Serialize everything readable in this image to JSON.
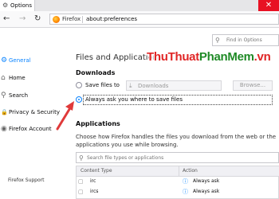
{
  "tab": {
    "title": "Options"
  },
  "window": {
    "close_glyph": "✕"
  },
  "toolbar": {
    "back_glyph": "←",
    "forward_glyph": "→",
    "reload_glyph": "↻"
  },
  "urlbar": {
    "identity": "Firefox",
    "url": "about:preferences"
  },
  "search": {
    "placeholder": "Find in Options"
  },
  "sidebar": {
    "items": [
      {
        "label": "General",
        "icon": "gear-icon",
        "glyph": "⚙",
        "active": true
      },
      {
        "label": "Home",
        "icon": "home-icon",
        "glyph": "⌂"
      },
      {
        "label": "Search",
        "icon": "search-icon",
        "glyph": "⚲"
      },
      {
        "label": "Privacy & Security",
        "icon": "lock-icon",
        "glyph": "🔒"
      },
      {
        "label": "Firefox Account",
        "icon": "account-icon",
        "glyph": "◉"
      }
    ],
    "support": "Firefox Support"
  },
  "main": {
    "section_title": "Files and Applications",
    "downloads": {
      "heading": "Downloads",
      "save_label": "Save files to",
      "folder": "Downloads",
      "browse": "Browse...",
      "ask_label": "Always ask you where to save files"
    },
    "applications": {
      "heading": "Applications",
      "description": "Choose how Firefox handles the files you download from the web or the applications you use while browsing.",
      "search_placeholder": "Search file types or applications",
      "columns": [
        "Content Type",
        "Action"
      ],
      "rows": [
        {
          "type": "irc",
          "action": "Always ask"
        },
        {
          "type": "ircs",
          "action": "Always ask"
        }
      ]
    }
  },
  "watermark": {
    "part1": "ThuThuat",
    "part2": "PhanMem",
    "part3": ".vn"
  },
  "colors": {
    "accent": "#0a84ff",
    "arrow": "#e03a3a",
    "close": "#e81123",
    "watermark_red": "#e02626",
    "watermark_green": "#1f8a26"
  }
}
